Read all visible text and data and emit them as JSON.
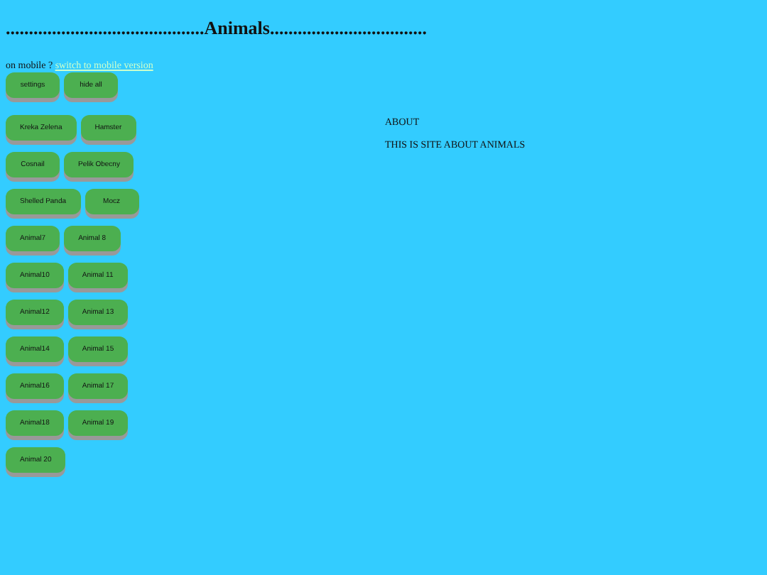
{
  "header": {
    "title": "...........................................Animals.................................."
  },
  "mobile_notice": {
    "text": "on mobile ?",
    "link": "switch to mobile version"
  },
  "controls": [
    "settings",
    "hide all"
  ],
  "animal_rows": [
    [
      "Kreka Zelena",
      "Hamster"
    ],
    [
      "Cosnail",
      "Pelik Obecny"
    ],
    [
      "Shelled Panda",
      "Mocz"
    ],
    [
      "Animal7",
      "Animal 8"
    ],
    [
      "Animal10",
      "Animal 11"
    ],
    [
      "Animal12",
      "Animal 13"
    ],
    [
      "Animal14",
      "Animal 15"
    ],
    [
      "Animal16",
      "Animal 17"
    ],
    [
      "Animal18",
      "Animal 19"
    ],
    [
      "Animal 20"
    ]
  ],
  "about": {
    "heading": "ABOUT",
    "text": "THIS IS SITE ABOUT ANIMALS"
  }
}
